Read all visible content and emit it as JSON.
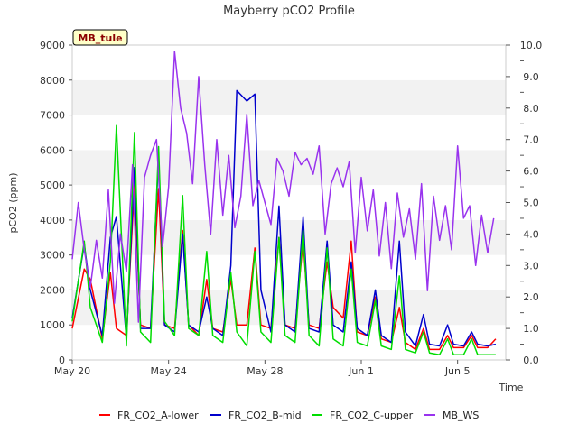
{
  "chart_data": {
    "type": "line",
    "title": "Mayberry pCO2 Profile",
    "xlabel": "Time",
    "ylabel": "pCO2 (ppm)",
    "ylabel_right": "",
    "xlim": [
      "2024-05-20",
      "2024-06-07"
    ],
    "ylim": [
      0,
      9000
    ],
    "ylim_right": [
      0,
      10
    ],
    "x_ticks": [
      {
        "date": "2024-05-20",
        "label": "May 20"
      },
      {
        "date": "2024-05-24",
        "label": "May 24"
      },
      {
        "date": "2024-05-28",
        "label": "May 28"
      },
      {
        "date": "2024-06-01",
        "label": "Jun 1"
      },
      {
        "date": "2024-06-05",
        "label": "Jun 5"
      }
    ],
    "y_ticks": [
      "0",
      "1000",
      "2000",
      "3000",
      "4000",
      "5000",
      "6000",
      "7000",
      "8000",
      "9000"
    ],
    "y_ticks_right": [
      "0.0",
      "1.0",
      "2.0",
      "3.0",
      "4.0",
      "5.0",
      "6.0",
      "7.0",
      "8.0",
      "9.0",
      "10.0"
    ],
    "grid": "horizontal bands",
    "legend_position": "bottom",
    "site_label": "MB_tule",
    "series": [
      {
        "name": "FR_CO2_A-lower",
        "color": "#ff0000",
        "axis": "left",
        "x": [
          "2024-05-20T00:00",
          "2024-05-20T12:00",
          "2024-05-20T18:00",
          "2024-05-21T06:00",
          "2024-05-21T14:00",
          "2024-05-21T20:00",
          "2024-05-22T06:00",
          "2024-05-22T14:00",
          "2024-05-22T20:00",
          "2024-05-23T06:00",
          "2024-05-23T14:00",
          "2024-05-23T20:00",
          "2024-05-24T06:00",
          "2024-05-24T14:00",
          "2024-05-24T20:00",
          "2024-05-25T06:00",
          "2024-05-25T14:00",
          "2024-05-25T20:00",
          "2024-05-26T06:00",
          "2024-05-26T14:00",
          "2024-05-26T20:00",
          "2024-05-27T06:00",
          "2024-05-27T14:00",
          "2024-05-27T20:00",
          "2024-05-28T06:00",
          "2024-05-28T14:00",
          "2024-05-28T20:00",
          "2024-05-29T06:00",
          "2024-05-29T14:00",
          "2024-05-29T20:00",
          "2024-05-30T06:00",
          "2024-05-30T14:00",
          "2024-05-30T20:00",
          "2024-05-31T06:00",
          "2024-05-31T14:00",
          "2024-05-31T20:00",
          "2024-06-01T06:00",
          "2024-06-01T14:00",
          "2024-06-01T20:00",
          "2024-06-02T06:00",
          "2024-06-02T14:00",
          "2024-06-02T20:00",
          "2024-06-03T06:00",
          "2024-06-03T14:00",
          "2024-06-03T20:00",
          "2024-06-04T06:00",
          "2024-06-04T14:00",
          "2024-06-04T20:00",
          "2024-06-05T06:00",
          "2024-06-05T14:00",
          "2024-06-05T20:00",
          "2024-06-06T06:00",
          "2024-06-06T14:00"
        ],
        "values": [
          900,
          2600,
          2300,
          600,
          2500,
          900,
          700,
          5000,
          1000,
          900,
          4900,
          1000,
          900,
          3700,
          1000,
          700,
          2300,
          900,
          800,
          2300,
          1000,
          1000,
          3200,
          1000,
          900,
          3500,
          1000,
          900,
          3400,
          1000,
          900,
          2800,
          1500,
          1200,
          3400,
          800,
          700,
          1800,
          600,
          500,
          1500,
          500,
          300,
          900,
          300,
          300,
          700,
          350,
          350,
          700,
          350,
          350,
          600
        ]
      },
      {
        "name": "FR_CO2_B-mid",
        "color": "#0000cc",
        "axis": "left",
        "x": [
          "2024-05-20T00:00",
          "2024-05-20T12:00",
          "2024-05-20T18:00",
          "2024-05-21T06:00",
          "2024-05-21T14:00",
          "2024-05-21T20:00",
          "2024-05-22T06:00",
          "2024-05-22T14:00",
          "2024-05-22T20:00",
          "2024-05-23T06:00",
          "2024-05-23T14:00",
          "2024-05-23T20:00",
          "2024-05-24T06:00",
          "2024-05-24T14:00",
          "2024-05-24T20:00",
          "2024-05-25T06:00",
          "2024-05-25T14:00",
          "2024-05-25T20:00",
          "2024-05-26T06:00",
          "2024-05-26T14:00",
          "2024-05-26T20:00",
          "2024-05-27T06:00",
          "2024-05-27T14:00",
          "2024-05-27T20:00",
          "2024-05-28T06:00",
          "2024-05-28T14:00",
          "2024-05-28T20:00",
          "2024-05-29T06:00",
          "2024-05-29T14:00",
          "2024-05-29T20:00",
          "2024-05-30T06:00",
          "2024-05-30T14:00",
          "2024-05-30T20:00",
          "2024-05-31T06:00",
          "2024-05-31T14:00",
          "2024-05-31T20:00",
          "2024-06-01T06:00",
          "2024-06-01T14:00",
          "2024-06-01T20:00",
          "2024-06-02T06:00",
          "2024-06-02T14:00",
          "2024-06-02T20:00",
          "2024-06-03T06:00",
          "2024-06-03T14:00",
          "2024-06-03T20:00",
          "2024-06-04T06:00",
          "2024-06-04T14:00",
          "2024-06-04T20:00",
          "2024-06-05T06:00",
          "2024-06-05T14:00",
          "2024-06-05T20:00",
          "2024-06-06T06:00",
          "2024-06-06T14:00"
        ],
        "values": [
          1200,
          3300,
          2000,
          700,
          3500,
          4100,
          600,
          5500,
          900,
          900,
          5800,
          1000,
          800,
          3600,
          1000,
          800,
          1800,
          900,
          700,
          2700,
          7700,
          7400,
          7600,
          2000,
          800,
          4400,
          1000,
          800,
          4100,
          900,
          800,
          3400,
          1000,
          800,
          2800,
          900,
          700,
          2000,
          700,
          500,
          3400,
          800,
          400,
          1300,
          450,
          400,
          1000,
          450,
          400,
          800,
          450,
          400,
          450
        ]
      },
      {
        "name": "FR_CO2_C-upper",
        "color": "#00dd00",
        "axis": "left",
        "x": [
          "2024-05-20T00:00",
          "2024-05-20T12:00",
          "2024-05-20T18:00",
          "2024-05-21T06:00",
          "2024-05-21T14:00",
          "2024-05-21T20:00",
          "2024-05-22T06:00",
          "2024-05-22T14:00",
          "2024-05-22T20:00",
          "2024-05-23T06:00",
          "2024-05-23T14:00",
          "2024-05-23T20:00",
          "2024-05-24T06:00",
          "2024-05-24T14:00",
          "2024-05-24T20:00",
          "2024-05-25T06:00",
          "2024-05-25T14:00",
          "2024-05-25T20:00",
          "2024-05-26T06:00",
          "2024-05-26T14:00",
          "2024-05-26T20:00",
          "2024-05-27T06:00",
          "2024-05-27T14:00",
          "2024-05-27T20:00",
          "2024-05-28T06:00",
          "2024-05-28T14:00",
          "2024-05-28T20:00",
          "2024-05-29T06:00",
          "2024-05-29T14:00",
          "2024-05-29T20:00",
          "2024-05-30T06:00",
          "2024-05-30T14:00",
          "2024-05-30T20:00",
          "2024-05-31T06:00",
          "2024-05-31T14:00",
          "2024-05-31T20:00",
          "2024-06-01T06:00",
          "2024-06-01T14:00",
          "2024-06-01T20:00",
          "2024-06-02T06:00",
          "2024-06-02T14:00",
          "2024-06-02T20:00",
          "2024-06-03T06:00",
          "2024-06-03T14:00",
          "2024-06-03T20:00",
          "2024-06-04T06:00",
          "2024-06-04T14:00",
          "2024-06-04T20:00",
          "2024-06-05T06:00",
          "2024-06-05T14:00",
          "2024-06-05T20:00",
          "2024-06-06T06:00",
          "2024-06-06T14:00"
        ],
        "values": [
          1100,
          3400,
          1500,
          500,
          2800,
          6700,
          400,
          6500,
          800,
          500,
          6100,
          1100,
          700,
          4700,
          900,
          700,
          3100,
          700,
          500,
          2500,
          800,
          400,
          3100,
          800,
          500,
          3500,
          700,
          500,
          3700,
          700,
          400,
          3200,
          600,
          400,
          2600,
          500,
          400,
          1700,
          400,
          300,
          2400,
          300,
          200,
          800,
          200,
          150,
          600,
          150,
          150,
          600,
          150,
          150,
          150
        ]
      },
      {
        "name": "MB_WS",
        "color": "#9933ee",
        "axis": "right",
        "x": [
          "2024-05-20T00:00",
          "2024-05-20T06:00",
          "2024-05-20T12:00",
          "2024-05-20T18:00",
          "2024-05-21T00:00",
          "2024-05-21T06:00",
          "2024-05-21T12:00",
          "2024-05-21T18:00",
          "2024-05-22T00:00",
          "2024-05-22T06:00",
          "2024-05-22T12:00",
          "2024-05-22T18:00",
          "2024-05-23T00:00",
          "2024-05-23T06:00",
          "2024-05-23T12:00",
          "2024-05-23T18:00",
          "2024-05-24T00:00",
          "2024-05-24T06:00",
          "2024-05-24T12:00",
          "2024-05-24T18:00",
          "2024-05-25T00:00",
          "2024-05-25T06:00",
          "2024-05-25T12:00",
          "2024-05-25T18:00",
          "2024-05-26T00:00",
          "2024-05-26T06:00",
          "2024-05-26T12:00",
          "2024-05-26T18:00",
          "2024-05-27T00:00",
          "2024-05-27T06:00",
          "2024-05-27T12:00",
          "2024-05-27T18:00",
          "2024-05-28T00:00",
          "2024-05-28T06:00",
          "2024-05-28T12:00",
          "2024-05-28T18:00",
          "2024-05-29T00:00",
          "2024-05-29T06:00",
          "2024-05-29T12:00",
          "2024-05-29T18:00",
          "2024-05-30T00:00",
          "2024-05-30T06:00",
          "2024-05-30T12:00",
          "2024-05-30T18:00",
          "2024-05-31T00:00",
          "2024-05-31T06:00",
          "2024-05-31T12:00",
          "2024-05-31T18:00",
          "2024-06-01T00:00",
          "2024-06-01T06:00",
          "2024-06-01T12:00",
          "2024-06-01T18:00",
          "2024-06-02T00:00",
          "2024-06-02T06:00",
          "2024-06-02T12:00",
          "2024-06-02T18:00",
          "2024-06-03T00:00",
          "2024-06-03T06:00",
          "2024-06-03T12:00",
          "2024-06-03T18:00",
          "2024-06-04T00:00",
          "2024-06-04T06:00",
          "2024-06-04T12:00",
          "2024-06-04T18:00",
          "2024-06-05T00:00",
          "2024-06-05T06:00",
          "2024-06-05T12:00",
          "2024-06-05T18:00",
          "2024-06-06T00:00",
          "2024-06-06T06:00",
          "2024-06-06T12:00"
        ],
        "values": [
          3.2,
          5.0,
          3.5,
          2.3,
          3.8,
          2.6,
          5.4,
          1.8,
          4.0,
          2.8,
          6.2,
          1.2,
          5.8,
          6.5,
          7.0,
          3.6,
          5.5,
          9.8,
          8.0,
          7.2,
          5.6,
          9.0,
          6.2,
          4.0,
          7.0,
          4.6,
          6.5,
          4.2,
          5.2,
          7.8,
          4.9,
          5.7,
          5.0,
          4.3,
          6.4,
          6.0,
          5.2,
          6.6,
          6.2,
          6.4,
          5.9,
          6.8,
          4.0,
          5.6,
          6.1,
          5.5,
          6.3,
          3.4,
          5.8,
          4.1,
          5.4,
          3.3,
          5.0,
          2.9,
          5.3,
          3.9,
          4.8,
          3.2,
          5.6,
          2.2,
          5.2,
          3.8,
          4.9,
          3.5,
          6.8,
          4.5,
          4.9,
          3.0,
          4.6,
          3.4,
          4.5
        ]
      }
    ]
  }
}
